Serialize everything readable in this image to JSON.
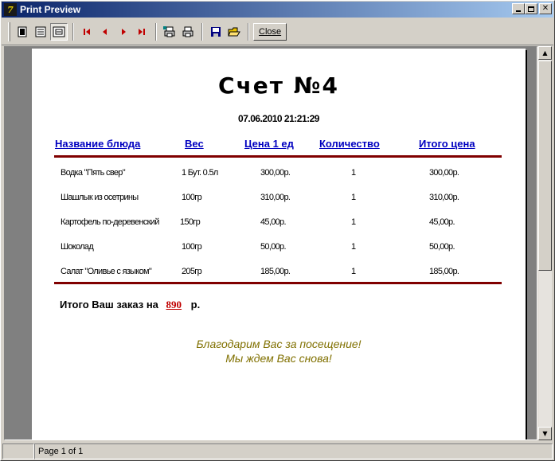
{
  "window": {
    "title": "Print Preview",
    "icon_text": "7"
  },
  "toolbar": {
    "buttons": [
      {
        "name": "one-page-icon"
      },
      {
        "name": "page-width-icon"
      },
      {
        "name": "zoom-icon"
      },
      {
        "name": "first-page-icon"
      },
      {
        "name": "prev-page-icon"
      },
      {
        "name": "next-page-icon"
      },
      {
        "name": "last-page-icon"
      },
      {
        "name": "print-setup-icon"
      },
      {
        "name": "print-icon"
      },
      {
        "name": "save-icon"
      },
      {
        "name": "open-icon"
      }
    ],
    "close_label": "Close"
  },
  "status": {
    "page": "Page 1 of 1"
  },
  "document": {
    "title": "Счет №4",
    "datetime": "07.06.2010 21:21:29",
    "columns": [
      "Название блюда",
      "Вес",
      "Цена 1 ед",
      "Количество",
      "Итого цена"
    ],
    "rows": [
      [
        "Водка \"Пять свер\"",
        "1 Бут. 0.5л",
        "300,00р.",
        "1",
        "300,00р."
      ],
      [
        "Шашлык из осетрины",
        "100гр",
        "310,00р.",
        "1",
        "310,00р."
      ],
      [
        "Картофель по-деревенский",
        "150гр",
        "45,00р.",
        "1",
        "45,00р."
      ],
      [
        "Шоколад",
        "100гр",
        "50,00р.",
        "1",
        "50,00р."
      ],
      [
        "Салат \"Оливье с языком\"",
        "205гр",
        "185,00р.",
        "1",
        "185,00р."
      ]
    ],
    "total_label": "Итого Ваш заказ на",
    "total_amount": "890",
    "total_currency": "р.",
    "thanks_line1": "Благодарим Вас за посещение!",
    "thanks_line2": "Мы ждем Вас снова!"
  },
  "colors": {
    "accent_rule": "#800000",
    "header_link": "#0000c0",
    "total_amount": "#c00000",
    "thanks": "#807000"
  }
}
